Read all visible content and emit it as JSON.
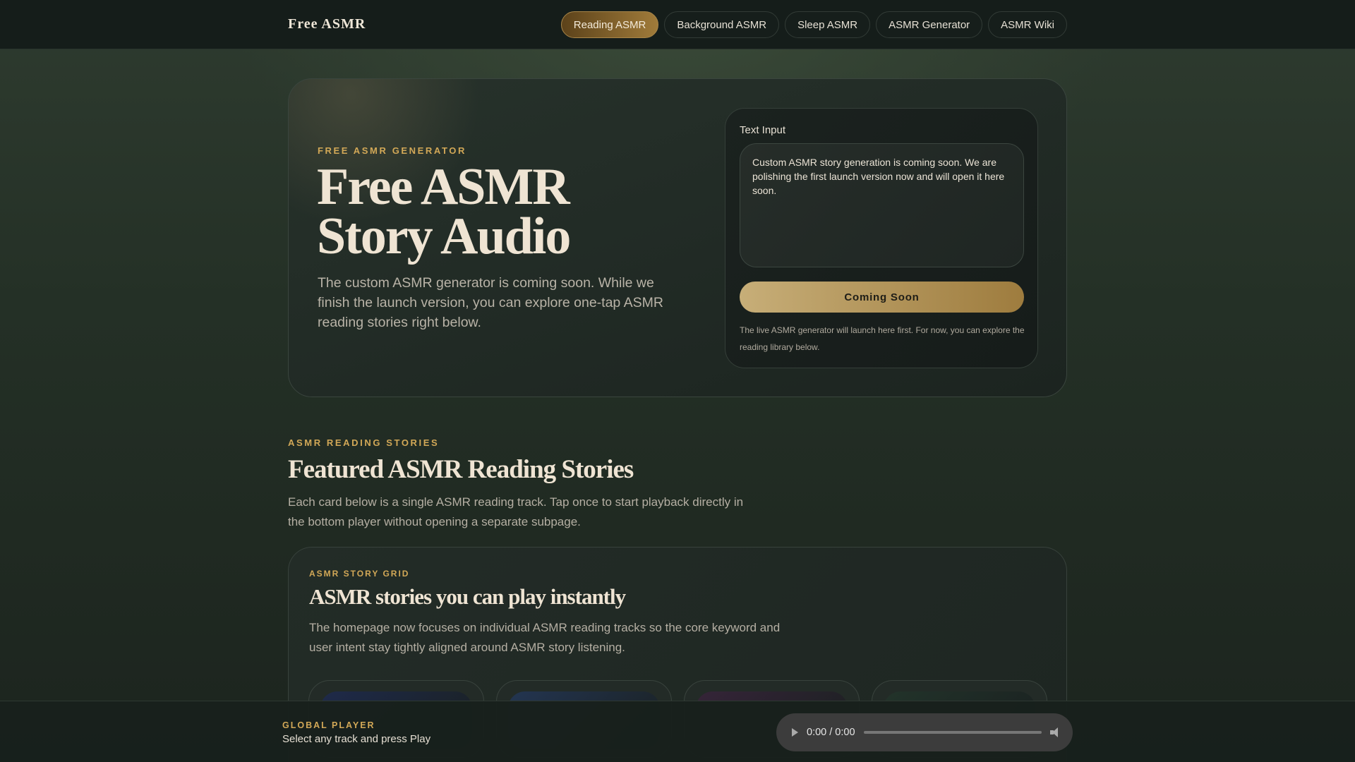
{
  "nav": {
    "logo": "Free ASMR",
    "items": [
      {
        "label": "Reading ASMR",
        "active": true
      },
      {
        "label": "Background ASMR"
      },
      {
        "label": "Sleep ASMR"
      },
      {
        "label": "ASMR Generator"
      },
      {
        "label": "ASMR Wiki"
      }
    ]
  },
  "hero": {
    "eyebrow": "FREE ASMR GENERATOR",
    "title_line1": "Free ASMR",
    "title_line2": "Story Audio",
    "description": "The custom ASMR generator is coming soon. While we finish the launch version, you can explore one-tap ASMR reading stories right below.",
    "form": {
      "label": "Text Input",
      "value": "Custom ASMR story generation is coming soon. We are polishing the first launch version now and will open it here soon.",
      "button": "Coming Soon",
      "note": "The live ASMR generator will launch here first. For now, you can explore the reading library below."
    }
  },
  "section": {
    "eyebrow": "ASMR READING STORIES",
    "title": "Featured ASMR Reading Stories",
    "description": "Each card below is a single ASMR reading track. Tap once to start playback directly in the bottom player without opening a separate subpage."
  },
  "grid": {
    "eyebrow": "ASMR STORY GRID",
    "title": "ASMR stories you can play instantly",
    "description": "The homepage now focuses on individual ASMR reading tracks so the core keyword and user intent stay tightly aligned around ASMR story listening.",
    "card_colors": [
      "#1e2a4a",
      "#233551",
      "#352438",
      "#22332a"
    ]
  },
  "player": {
    "eyebrow": "GLOBAL PLAYER",
    "status": "Select any track and press Play",
    "time": "0:00 / 0:00"
  }
}
